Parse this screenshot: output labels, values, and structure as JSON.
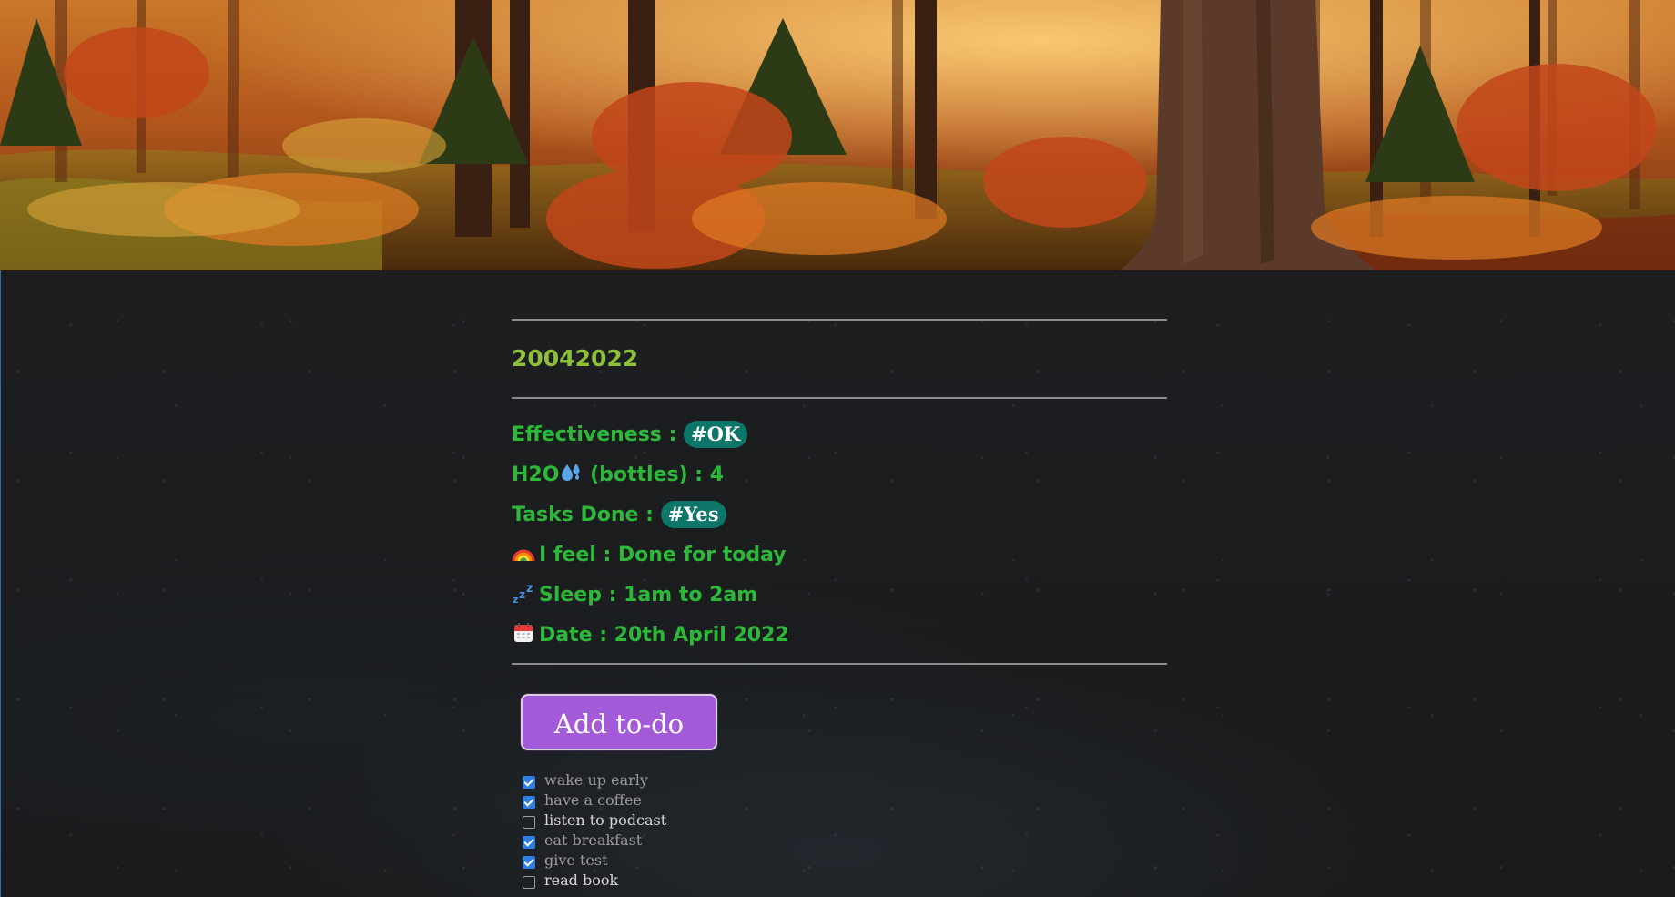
{
  "journal": {
    "title": "20042022"
  },
  "properties": [
    {
      "key": "effectiveness",
      "label": "Effectiveness : ",
      "tag": "#OK"
    },
    {
      "key": "h2o",
      "label_prefix": "H2O",
      "emoji": "sweat-droplets-icon",
      "label_suffix": " (bottles) : 4"
    },
    {
      "key": "tasks_done",
      "label": "Tasks Done : ",
      "tag": "#Yes"
    },
    {
      "key": "feel",
      "emoji": "rainbow-icon",
      "label": "I feel : Done for today"
    },
    {
      "key": "sleep",
      "emoji": "zzz-icon",
      "label": "Sleep : 1am to 2am"
    },
    {
      "key": "date",
      "emoji": "calendar-icon",
      "label": "Date : 20th April 2022"
    }
  ],
  "add_button": {
    "label": "Add to-do"
  },
  "todos": [
    {
      "text": "wake up early",
      "checked": true
    },
    {
      "text": "have a coffee",
      "checked": true
    },
    {
      "text": "listen to podcast",
      "checked": false
    },
    {
      "text": "eat breakfast",
      "checked": true
    },
    {
      "text": "give test",
      "checked": true
    },
    {
      "text": "read book",
      "checked": false
    }
  ],
  "colors": {
    "property_text": "#2db83a",
    "title_text": "#8ec03a",
    "tag_bg": "#0e7569",
    "button_bg": "#a35ad8",
    "checkbox_checked": "#2f7fe0"
  },
  "banner": {
    "description_icon": "autumn-forest-image"
  }
}
